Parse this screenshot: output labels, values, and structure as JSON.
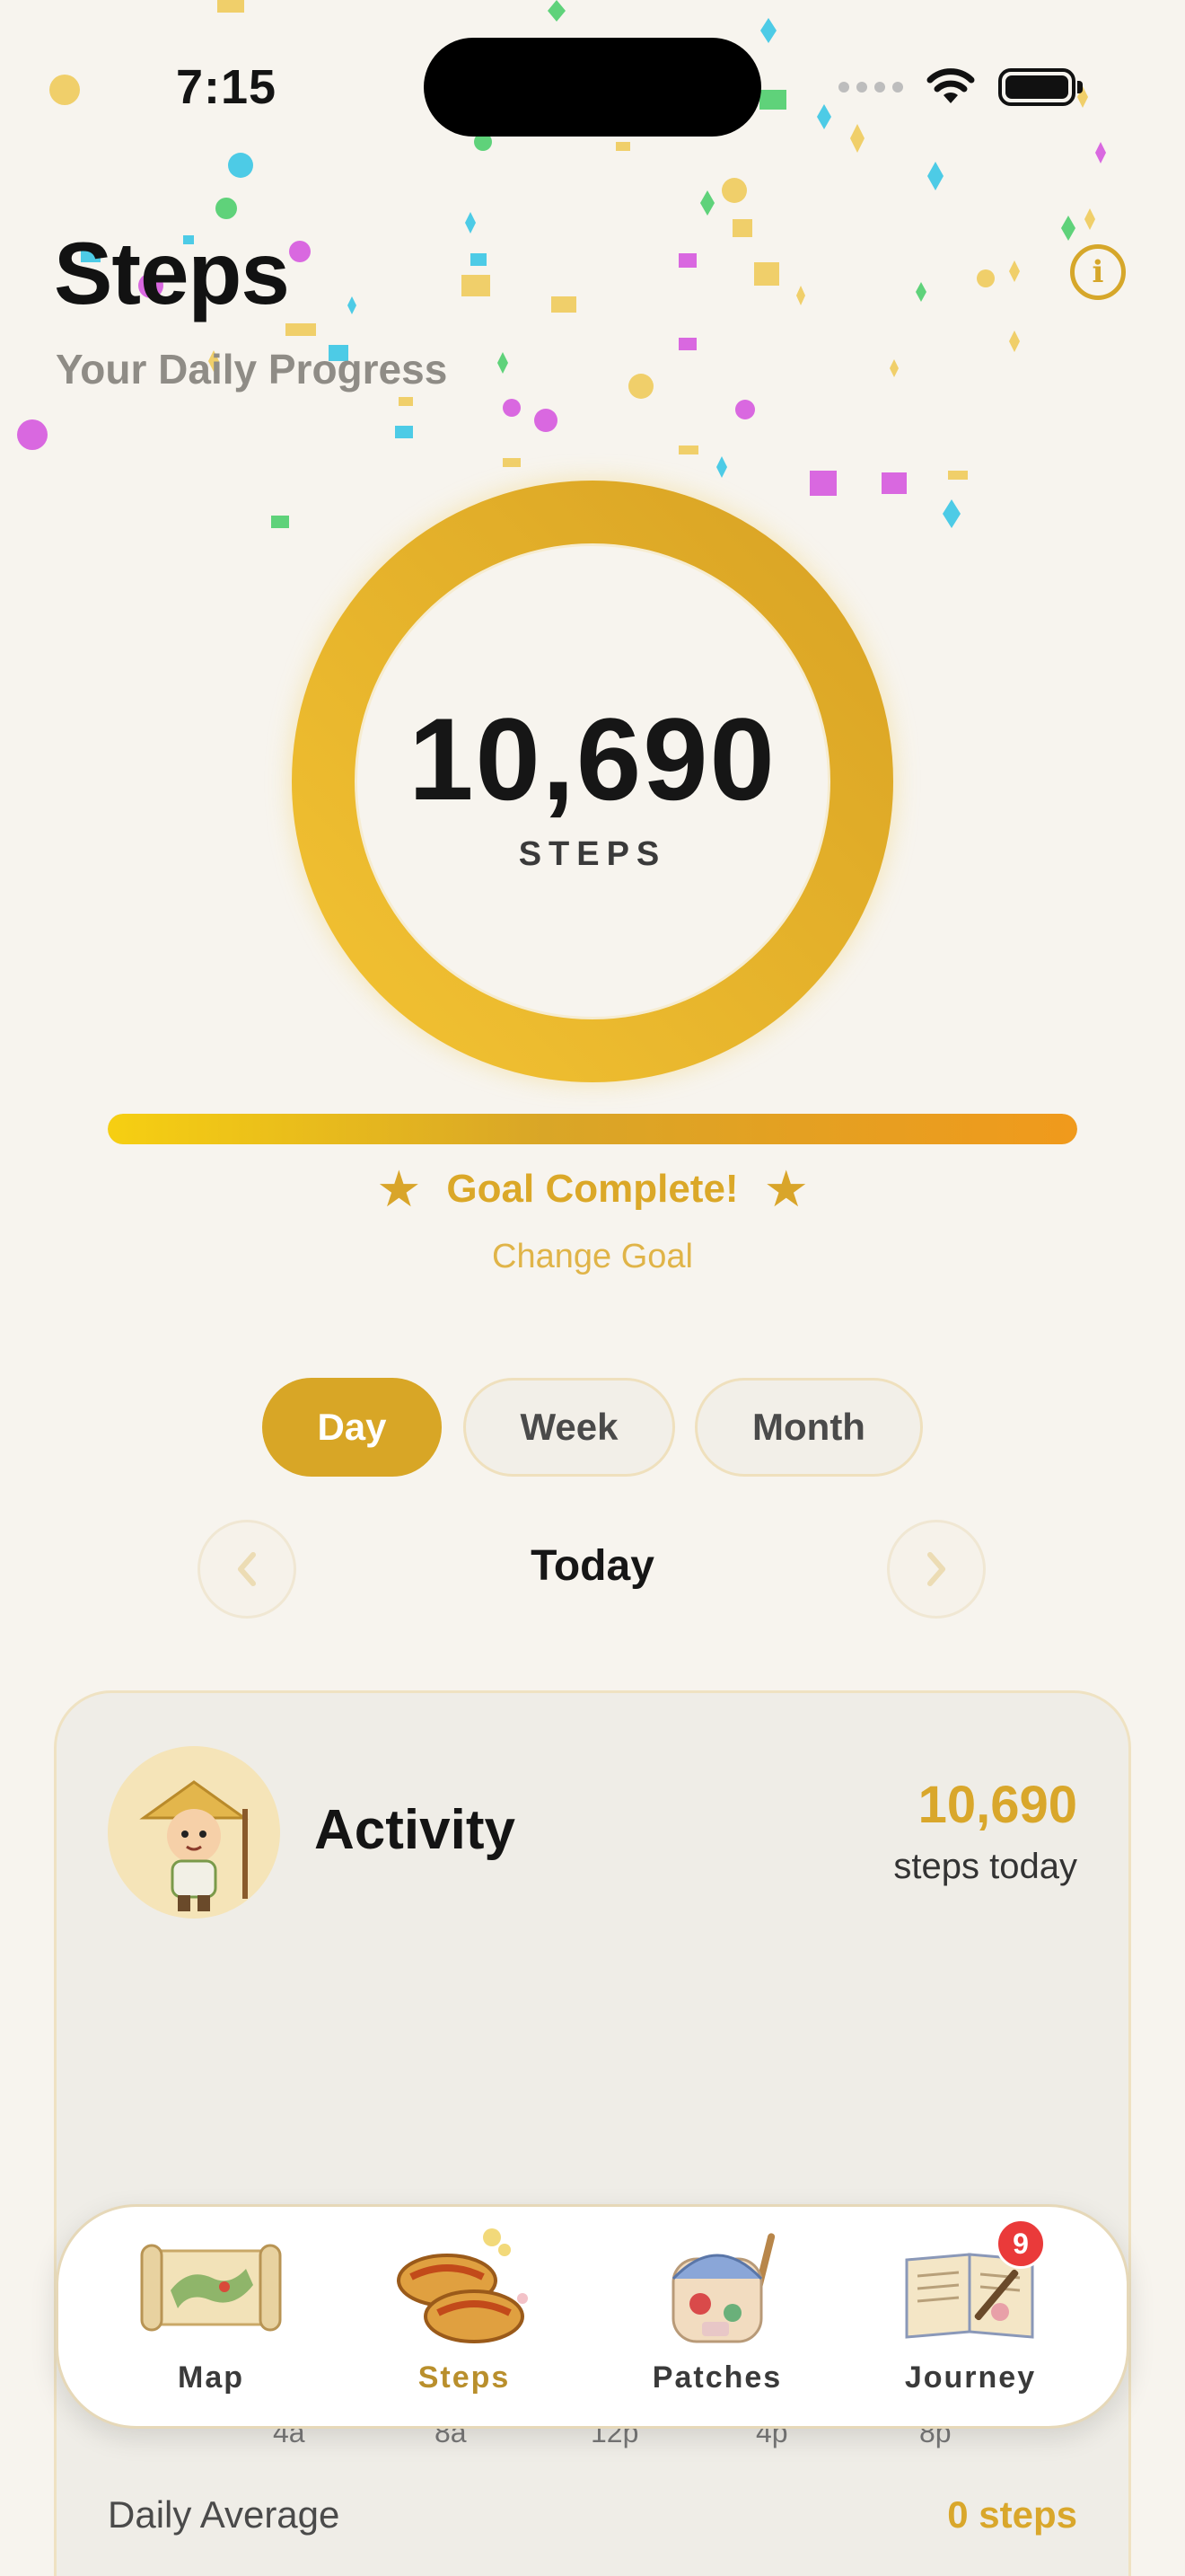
{
  "status": {
    "time": "7:15"
  },
  "header": {
    "title": "Steps",
    "subtitle": "Your Daily Progress",
    "info_icon": "info-icon"
  },
  "ring": {
    "steps": "10,690",
    "label": "STEPS",
    "progress": 1.0
  },
  "progress_bar": {
    "fraction": 1.0
  },
  "goal": {
    "text": "Goal Complete!",
    "change_label": "Change Goal"
  },
  "segments": {
    "day": "Day",
    "week": "Week",
    "month": "Month",
    "selected": "Day"
  },
  "period": {
    "label": "Today"
  },
  "activity": {
    "title": "Activity",
    "count": "10,690",
    "count_sub": "steps today",
    "axis_labels": [
      "4a",
      "8a",
      "12p",
      "4p",
      "8p"
    ],
    "avg_label": "Daily Average",
    "avg_value": "0 steps"
  },
  "tabs": [
    {
      "label": "Map",
      "icon": "map-scroll-icon"
    },
    {
      "label": "Steps",
      "icon": "sandals-icon",
      "active": true
    },
    {
      "label": "Patches",
      "icon": "backpack-icon"
    },
    {
      "label": "Journey",
      "icon": "journal-icon",
      "badge": "9"
    }
  ],
  "colors": {
    "accent": "#d8a626",
    "background": "#f7f4ee",
    "badge": "#ea3a3a"
  }
}
